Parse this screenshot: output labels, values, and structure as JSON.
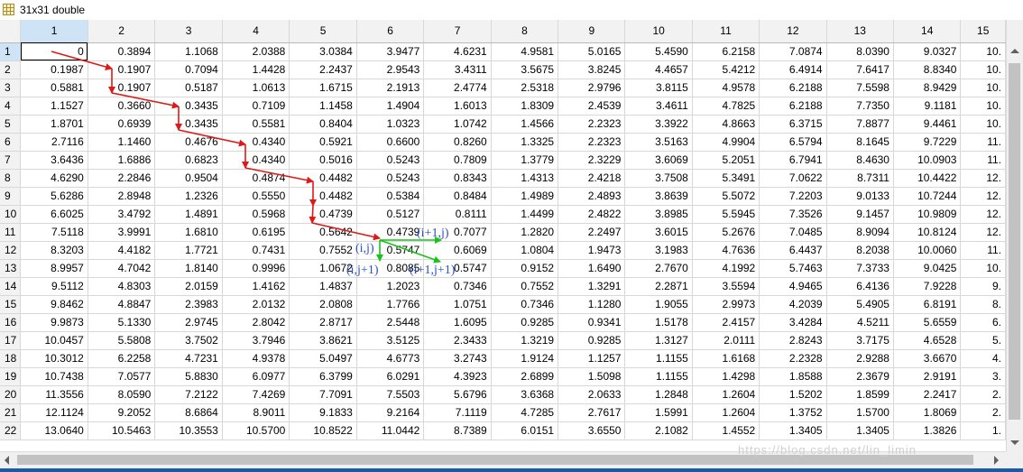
{
  "window": {
    "title": "31x31 double"
  },
  "columns": [
    "1",
    "2",
    "3",
    "4",
    "5",
    "6",
    "7",
    "8",
    "9",
    "10",
    "11",
    "12",
    "13",
    "14",
    "15"
  ],
  "rows": [
    {
      "label": "1",
      "cells": [
        "0",
        "0.3894",
        "1.1068",
        "2.0388",
        "3.0384",
        "3.9477",
        "4.6231",
        "4.9581",
        "5.0165",
        "5.4590",
        "6.2158",
        "7.0874",
        "8.0390",
        "9.0327",
        "10."
      ]
    },
    {
      "label": "2",
      "cells": [
        "0.1987",
        "0.1907",
        "0.7094",
        "1.4428",
        "2.2437",
        "2.9543",
        "3.4311",
        "3.5675",
        "3.8245",
        "4.4657",
        "5.4212",
        "6.4914",
        "7.6417",
        "8.8340",
        "10."
      ]
    },
    {
      "label": "3",
      "cells": [
        "0.5881",
        "0.1907",
        "0.5187",
        "1.0613",
        "1.6715",
        "2.1913",
        "2.4774",
        "2.5318",
        "2.9796",
        "3.8115",
        "4.9578",
        "6.2188",
        "7.5598",
        "8.9429",
        "10."
      ]
    },
    {
      "label": "4",
      "cells": [
        "1.1527",
        "0.3660",
        "0.3435",
        "0.7109",
        "1.1458",
        "1.4904",
        "1.6013",
        "1.8309",
        "2.4539",
        "3.4611",
        "4.7825",
        "6.2188",
        "7.7350",
        "9.1181",
        "10."
      ]
    },
    {
      "label": "5",
      "cells": [
        "1.8701",
        "0.6939",
        "0.3435",
        "0.5581",
        "0.8404",
        "1.0323",
        "1.0742",
        "1.4566",
        "2.2323",
        "3.3922",
        "4.8663",
        "6.3715",
        "7.8877",
        "9.4461",
        "10."
      ]
    },
    {
      "label": "6",
      "cells": [
        "2.7116",
        "1.1460",
        "0.4676",
        "0.4340",
        "0.5921",
        "0.6600",
        "0.8260",
        "1.3325",
        "2.2323",
        "3.5163",
        "4.9904",
        "6.5794",
        "8.1645",
        "9.7229",
        "11."
      ]
    },
    {
      "label": "7",
      "cells": [
        "3.6436",
        "1.6886",
        "0.6823",
        "0.4340",
        "0.5016",
        "0.5243",
        "0.7809",
        "1.3779",
        "2.3229",
        "3.6069",
        "5.2051",
        "6.7941",
        "8.4630",
        "10.0903",
        "11."
      ]
    },
    {
      "label": "8",
      "cells": [
        "4.6290",
        "2.2846",
        "0.9504",
        "0.4874",
        "0.4482",
        "0.5243",
        "0.8343",
        "1.4313",
        "2.4218",
        "3.7508",
        "5.3491",
        "7.0622",
        "8.7311",
        "10.4422",
        "12."
      ]
    },
    {
      "label": "9",
      "cells": [
        "5.6286",
        "2.8948",
        "1.2326",
        "0.5550",
        "0.4482",
        "0.5384",
        "0.8484",
        "1.4989",
        "2.4893",
        "3.8639",
        "5.5072",
        "7.2203",
        "9.0133",
        "10.7244",
        "12."
      ]
    },
    {
      "label": "10",
      "cells": [
        "6.6025",
        "3.4792",
        "1.4891",
        "0.5968",
        "0.4739",
        "0.5127",
        "0.8111",
        "1.4499",
        "2.4822",
        "3.8985",
        "5.5945",
        "7.3526",
        "9.1457",
        "10.9809",
        "12."
      ]
    },
    {
      "label": "11",
      "cells": [
        "7.5118",
        "3.9991",
        "1.6810",
        "0.6195",
        "0.5642",
        "0.4739",
        "0.7077",
        "1.2820",
        "2.2497",
        "3.6015",
        "5.2676",
        "7.0485",
        "8.9094",
        "10.8124",
        "12."
      ]
    },
    {
      "label": "12",
      "cells": [
        "8.3203",
        "4.4182",
        "1.7721",
        "0.7431",
        "0.7552",
        "0.5747",
        "0.6069",
        "1.0804",
        "1.9473",
        "3.1983",
        "4.7636",
        "6.4437",
        "8.2038",
        "10.0060",
        "11."
      ]
    },
    {
      "label": "13",
      "cells": [
        "8.9957",
        "4.7042",
        "1.8140",
        "0.9996",
        "1.0672",
        "0.8085",
        "0.5747",
        "0.9152",
        "1.6490",
        "2.7670",
        "4.1992",
        "5.7463",
        "7.3733",
        "9.0425",
        "10."
      ]
    },
    {
      "label": "14",
      "cells": [
        "9.5112",
        "4.8303",
        "2.0159",
        "1.4162",
        "1.4837",
        "1.2023",
        "0.7346",
        "0.7552",
        "1.3291",
        "2.2871",
        "3.5594",
        "4.9465",
        "6.4136",
        "7.9228",
        "9."
      ]
    },
    {
      "label": "15",
      "cells": [
        "9.8462",
        "4.8847",
        "2.3983",
        "2.0132",
        "2.0808",
        "1.7766",
        "1.0751",
        "0.7346",
        "1.1280",
        "1.9055",
        "2.9973",
        "4.2039",
        "5.4905",
        "6.8191",
        "8."
      ]
    },
    {
      "label": "16",
      "cells": [
        "9.9873",
        "5.1330",
        "2.9745",
        "2.8042",
        "2.8717",
        "2.5448",
        "1.6095",
        "0.9285",
        "0.9341",
        "1.5178",
        "2.4157",
        "3.4284",
        "4.5211",
        "5.6559",
        "6."
      ]
    },
    {
      "label": "17",
      "cells": [
        "10.0457",
        "5.5808",
        "3.7502",
        "3.7946",
        "3.8621",
        "3.5125",
        "2.3433",
        "1.3219",
        "0.9285",
        "1.3127",
        "2.0111",
        "2.8243",
        "3.7175",
        "4.6528",
        "5."
      ]
    },
    {
      "label": "18",
      "cells": [
        "10.3012",
        "6.2258",
        "4.7231",
        "4.9378",
        "5.0497",
        "4.6773",
        "3.2743",
        "1.9124",
        "1.1257",
        "1.1155",
        "1.6168",
        "2.2328",
        "2.9288",
        "3.6670",
        "4."
      ]
    },
    {
      "label": "19",
      "cells": [
        "10.7438",
        "7.0577",
        "5.8830",
        "6.0977",
        "6.3799",
        "6.0291",
        "4.3923",
        "2.6899",
        "1.5098",
        "1.1155",
        "1.4298",
        "1.8588",
        "2.3679",
        "2.9191",
        "3."
      ]
    },
    {
      "label": "20",
      "cells": [
        "11.3556",
        "8.0590",
        "7.2122",
        "7.4269",
        "7.7091",
        "7.5503",
        "5.6796",
        "3.6368",
        "2.0633",
        "1.2848",
        "1.2604",
        "1.5202",
        "1.8599",
        "2.2417",
        "2."
      ]
    },
    {
      "label": "21",
      "cells": [
        "12.1124",
        "9.2052",
        "8.6864",
        "8.9011",
        "9.1833",
        "9.2164",
        "7.1119",
        "4.7285",
        "2.7617",
        "1.5991",
        "1.2604",
        "1.3752",
        "1.5700",
        "1.8069",
        "2."
      ]
    },
    {
      "label": "22",
      "cells": [
        "13.0640",
        "10.5463",
        "10.3553",
        "10.5700",
        "10.8522",
        "11.0442",
        "8.7389",
        "6.0151",
        "3.6550",
        "2.1082",
        "1.4552",
        "1.3405",
        "1.3405",
        "1.3826",
        "1."
      ]
    }
  ],
  "annotations": {
    "ij": "(i,j)",
    "i1j": "(i+1,j)",
    "ij1": "(i,j+1)",
    "i1j1": "(i+1,j+1)"
  },
  "watermark": "https://blog.csdn.net/lin_limin",
  "colors": {
    "path_arrow": "#e01818",
    "step_arrow": "#18c418",
    "annotation_text": "#2a50d0"
  }
}
